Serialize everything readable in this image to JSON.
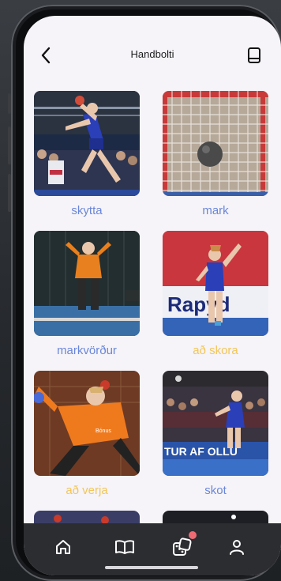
{
  "header": {
    "title": "Handbolti",
    "back_icon": "chevron-left-icon",
    "book_icon": "book-icon"
  },
  "cards": [
    {
      "label": "skytta",
      "label_color": "#6a86d9",
      "image": "handball-player-jump-shot"
    },
    {
      "label": "mark",
      "label_color": "#6a86d9",
      "image": "handball-goal-net-ball"
    },
    {
      "label": "markvörður",
      "label_color": "#6a86d9",
      "image": "goalkeeper-orange"
    },
    {
      "label": "að skora",
      "label_color": "#f2c65a",
      "image": "player-celebrating"
    },
    {
      "label": "að verja",
      "label_color": "#f2c65a",
      "image": "goalkeeper-save"
    },
    {
      "label": "skot",
      "label_color": "#6a86d9",
      "image": "player-shooting-arena"
    }
  ],
  "nav": {
    "items": [
      "home-icon",
      "book-open-icon",
      "dice-icon",
      "user-icon"
    ],
    "accent": "#ef6b73"
  }
}
